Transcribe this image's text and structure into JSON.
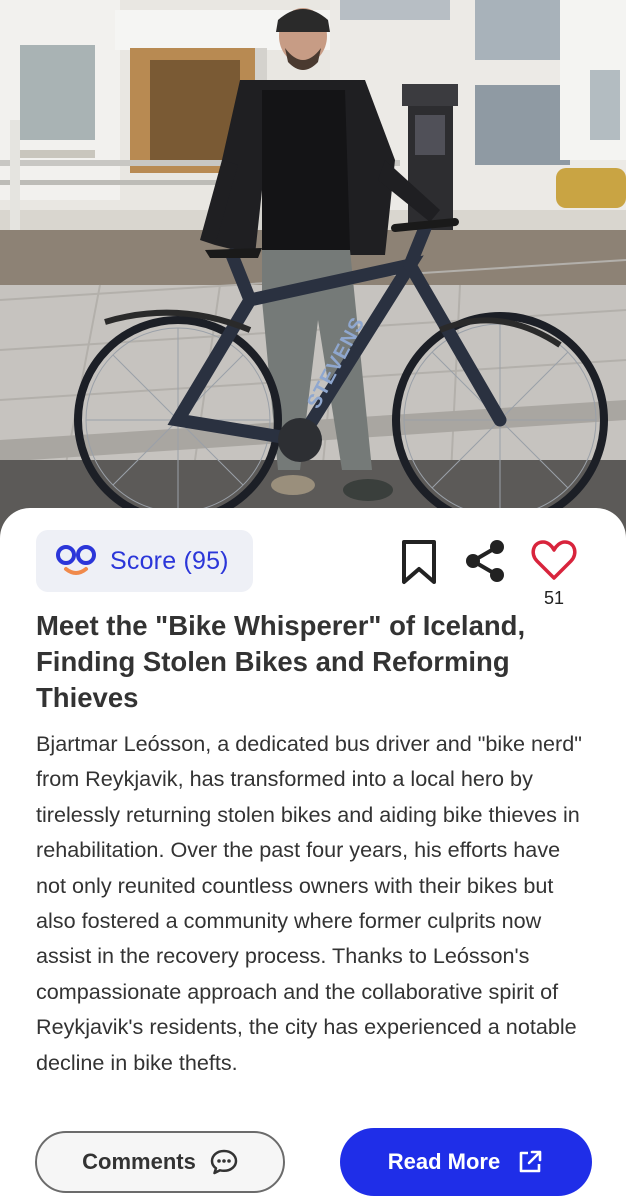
{
  "article": {
    "score_label": "Score (95)",
    "like_count": "51",
    "title": "Meet the \"Bike Whisperer\" of Iceland, Finding Stolen Bikes and Reforming Thieves",
    "body": "Bjartmar Leósson, a dedicated bus driver and \"bike nerd\" from Reykjavik, has transformed into a local hero by tirelessly returning stolen bikes and aiding bike thieves in rehabilitation. Over the past four years, his efforts have not only reunited countless owners with their bikes but also fostered a community where former culprits now assist in the recovery process. Thanks to Leósson's compassionate approach and the collaborative spirit of Reykjavik's residents, the city has experienced a notable decline in bike thefts."
  },
  "photo": {
    "bike_brand": "STEVENS"
  },
  "buttons": {
    "comments_label": "Comments",
    "read_more_label": "Read More"
  },
  "icons": {
    "score_logo": "score-logo-icon",
    "bookmark": "bookmark-icon",
    "share": "share-icon",
    "like": "heart-icon",
    "comments": "speech-bubble-icon",
    "read_more": "external-link-icon"
  },
  "colors": {
    "accent_blue": "#1f2ee8",
    "score_text": "#2b36d9",
    "heart_red": "#d8243c",
    "score_smile": "#f08a4b",
    "chip_background": "#eef0f6"
  }
}
